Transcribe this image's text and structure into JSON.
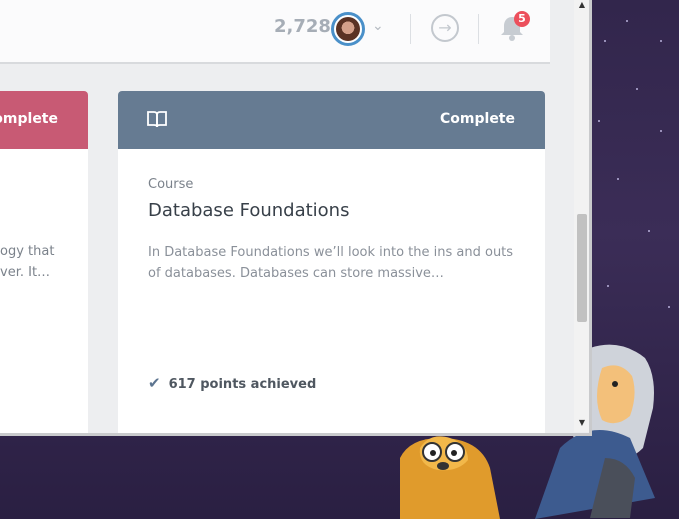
{
  "header": {
    "points": "2,728",
    "notifications_count": "5"
  },
  "cards": {
    "left": {
      "status": "Complete",
      "desc": "ogy that ver. It…"
    },
    "right": {
      "status": "Complete",
      "type": "Course",
      "title": "Database Foundations",
      "description": "In Database Foundations we’ll look into the ins and outs of databases. Databases can store massive…",
      "achievement": "617 points achieved"
    }
  },
  "colors": {
    "left_header": "#c85a74",
    "right_header": "#667b92",
    "badge": "#ec4f5c",
    "avatar_ring": "#4a90c9"
  },
  "icons": {
    "book": "book-icon",
    "check": "check-icon",
    "arrow": "arrow-right-circle-icon",
    "bell": "bell-icon",
    "chevron": "chevron-down-icon"
  }
}
